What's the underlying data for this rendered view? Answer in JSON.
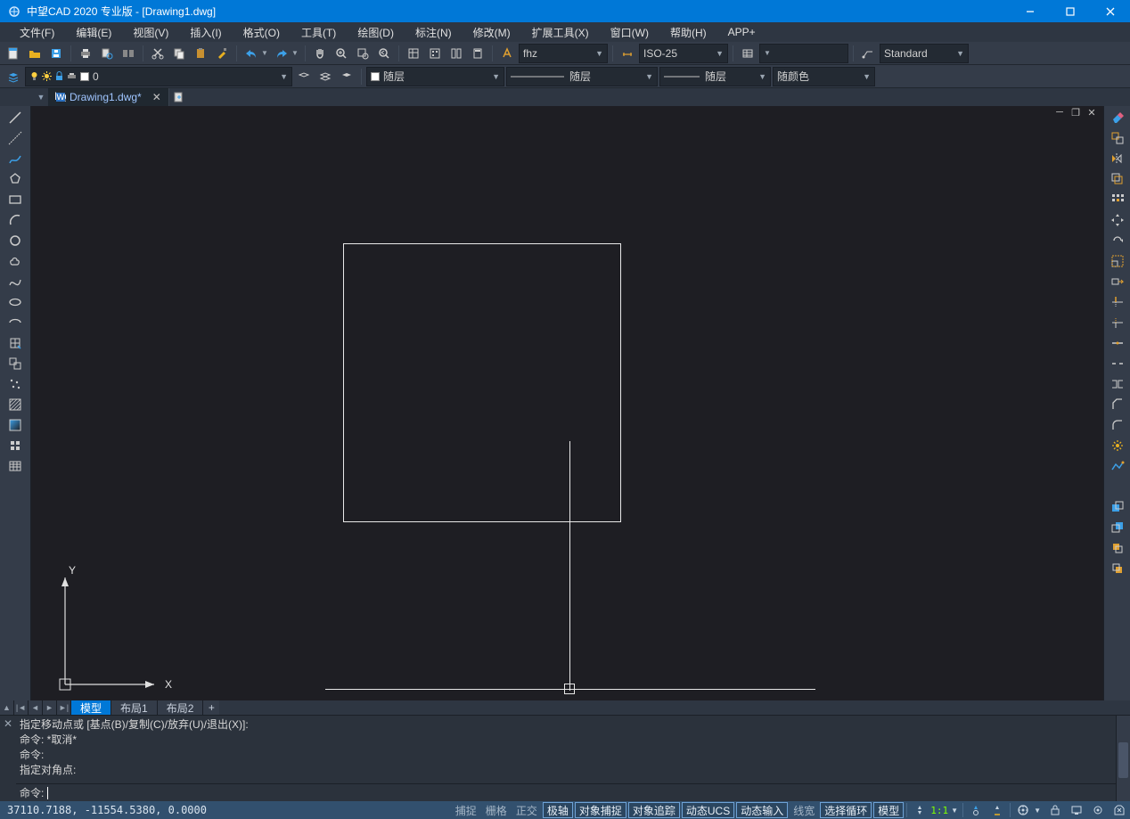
{
  "app_title": "中望CAD 2020 专业版 - [Drawing1.dwg]",
  "menubar": [
    "文件(F)",
    "编辑(E)",
    "视图(V)",
    "插入(I)",
    "格式(O)",
    "工具(T)",
    "绘图(D)",
    "标注(N)",
    "修改(M)",
    "扩展工具(X)",
    "窗口(W)",
    "帮助(H)",
    "APP+"
  ],
  "toolbar1": {
    "text_style": "fhz",
    "dim_style": "ISO-25",
    "table_style": "Standard"
  },
  "toolbar2": {
    "layer": "0",
    "color_label": "随层",
    "linetype_label": "随层",
    "lineweight_label": "随层",
    "plot_color_label": "随颜色"
  },
  "doc_tab": {
    "name": "Drawing1.dwg*"
  },
  "layout_tabs": {
    "active": "模型",
    "tabs": [
      "模型",
      "布局1",
      "布局2"
    ]
  },
  "ucs_labels": {
    "x": "X",
    "y": "Y"
  },
  "command": {
    "history": [
      "指定移动点或 [基点(B)/复制(C)/放弃(U)/退出(X)]:",
      "命令: *取消*",
      "命令:",
      "指定对角点:"
    ],
    "prompt": "命令:"
  },
  "status": {
    "coords": "37110.7188, -11554.5380, 0.0000",
    "toggles": [
      {
        "label": "捕捉",
        "on": false
      },
      {
        "label": "栅格",
        "on": false
      },
      {
        "label": "正交",
        "on": false
      },
      {
        "label": "极轴",
        "on": true
      },
      {
        "label": "对象捕捉",
        "on": true
      },
      {
        "label": "对象追踪",
        "on": true
      },
      {
        "label": "动态UCS",
        "on": true
      },
      {
        "label": "动态输入",
        "on": true
      },
      {
        "label": "线宽",
        "on": false
      },
      {
        "label": "选择循环",
        "on": true
      },
      {
        "label": "模型",
        "on": true
      }
    ],
    "scale": "1:1"
  }
}
